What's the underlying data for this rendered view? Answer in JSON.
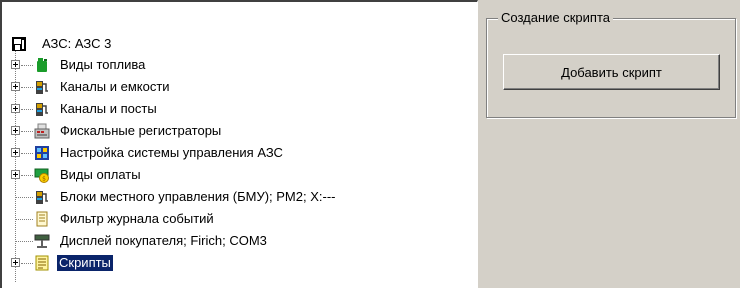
{
  "tree": {
    "root_label": "АЗС: АЗС 3",
    "items": [
      {
        "label": "Виды топлива",
        "icon": "fuel-canister-icon",
        "color": "#1a9c2a"
      },
      {
        "label": "Каналы и емкости",
        "icon": "fuel-dispenser-icon",
        "color": "#d4a000"
      },
      {
        "label": "Каналы и посты",
        "icon": "fuel-dispenser-icon",
        "color": "#d4a000"
      },
      {
        "label": "Фискальные регистраторы",
        "icon": "cash-register-icon",
        "color": "#c02020"
      },
      {
        "label": "Настройка системы управления АЗС",
        "icon": "control-panel-icon",
        "color": "#2040a0"
      },
      {
        "label": "Виды оплаты",
        "icon": "payment-icon",
        "color": "#e0a000"
      },
      {
        "label": "Блоки местного управления (БМУ);  PM2;  X:---",
        "icon": "fuel-dispenser-icon",
        "color": "#d4a000"
      },
      {
        "label": "Фильтр журнала событий",
        "icon": "journal-filter-icon",
        "color": "#c0a030"
      },
      {
        "label": "Дисплей покупателя; Firich; COM3",
        "icon": "customer-display-icon",
        "color": "#808060"
      },
      {
        "label": "Скрипты",
        "icon": "scripts-icon",
        "color": "#d4c000",
        "selected": true
      }
    ]
  },
  "script_group": {
    "title": "Создание скрипта",
    "add_button_label": "Добавить скрипт"
  }
}
